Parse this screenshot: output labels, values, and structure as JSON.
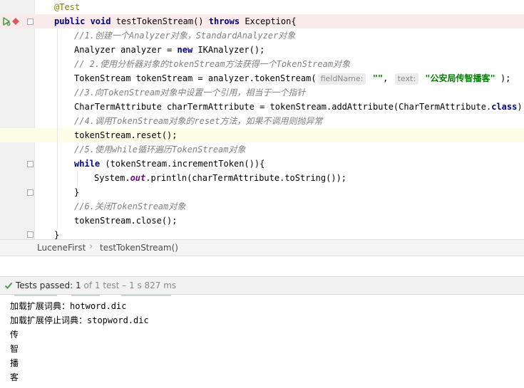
{
  "editor": {
    "lines": [
      {
        "id": "annotation",
        "parts": [
          {
            "t": "@Test",
            "c": "ann"
          }
        ]
      },
      {
        "id": "method-sig",
        "parts": [
          {
            "t": "public void ",
            "c": "kw"
          },
          {
            "t": "testTokenStream() "
          },
          {
            "t": "throws ",
            "c": "kw"
          },
          {
            "t": "Exception{"
          }
        ]
      },
      {
        "id": "comment-1",
        "parts": [
          {
            "t": "//1.创建一个Analyzer对象，StandardAnalyzer对象",
            "c": "cm"
          }
        ]
      },
      {
        "id": "analyzer-decl",
        "parts": [
          {
            "t": "Analyzer analyzer = "
          },
          {
            "t": "new ",
            "c": "kw"
          },
          {
            "t": "IKAnalyzer();"
          }
        ]
      },
      {
        "id": "comment-2",
        "parts": [
          {
            "t": "// 2.使用分析器对象的tokenStream方法获得一个TokenStream对象",
            "c": "cm"
          }
        ]
      },
      {
        "id": "tokenstream-decl",
        "parts": [
          {
            "t": "TokenStream tokenStream = analyzer.tokenStream("
          },
          {
            "t": "fieldName:",
            "c": "hint"
          },
          {
            "t": " "
          },
          {
            "t": "\"\"",
            "c": "str"
          },
          {
            "t": ", "
          },
          {
            "t": "text:",
            "c": "hint"
          },
          {
            "t": " "
          },
          {
            "t": "\"公安局传智播客\"",
            "c": "str"
          },
          {
            "t": " );"
          }
        ]
      },
      {
        "id": "comment-3",
        "parts": [
          {
            "t": "//3.向TokenStream对象中设置一个引用，相当于一个指针",
            "c": "cm"
          }
        ]
      },
      {
        "id": "attr-decl",
        "parts": [
          {
            "t": "CharTermAttribute charTermAttribute = tokenStream.addAttribute(CharTermAttribute."
          },
          {
            "t": "class",
            "c": "kw"
          },
          {
            "t": ");"
          }
        ]
      },
      {
        "id": "comment-4",
        "parts": [
          {
            "t": "//4.调用TokenStream对象的reset方法，如果不调用则抛异常",
            "c": "cm"
          }
        ]
      },
      {
        "id": "reset-call",
        "parts": [
          {
            "t": "tokenStream.reset();"
          }
        ]
      },
      {
        "id": "comment-5",
        "parts": [
          {
            "t": "//5.使用while循环遍历TokenStream对象",
            "c": "cm"
          }
        ]
      },
      {
        "id": "while-loop",
        "parts": [
          {
            "t": "while ",
            "c": "kw"
          },
          {
            "t": "(tokenStream.incrementToken()){"
          }
        ]
      },
      {
        "id": "println-call",
        "parts": [
          {
            "t": "System."
          },
          {
            "t": "out",
            "c": "fld"
          },
          {
            "t": ".println(charTermAttribute.toString());"
          }
        ]
      },
      {
        "id": "loop-close",
        "parts": [
          {
            "t": "}"
          }
        ]
      },
      {
        "id": "comment-6",
        "parts": [
          {
            "t": "//6.关闭TokenStream对象",
            "c": "cm"
          }
        ]
      },
      {
        "id": "close-call",
        "parts": [
          {
            "t": "tokenStream.close();"
          }
        ]
      },
      {
        "id": "method-close",
        "parts": [
          {
            "t": "}"
          }
        ]
      }
    ]
  },
  "breadcrumb": {
    "items": [
      "LuceneFirst",
      "testTokenStream()"
    ],
    "separator": "›"
  },
  "tests": {
    "status_label": "Tests passed: ",
    "passed_count": "1",
    "detail": " of 1 test – 1 s 827 ms",
    "status_icon": "check-icon",
    "status_color": "#499c54"
  },
  "console": {
    "lines": [
      "加载扩展词典：hotword.dic",
      "加载扩展停止词典：stopword.dic",
      "传",
      "智",
      "播",
      "客"
    ]
  },
  "colors": {
    "keyword": "#000080",
    "comment": "#808080",
    "string": "#008000",
    "annotation": "#808000",
    "error_line": "#fbeaea",
    "caret_line": "#fdfce6",
    "breakpoint": "#db5860"
  }
}
